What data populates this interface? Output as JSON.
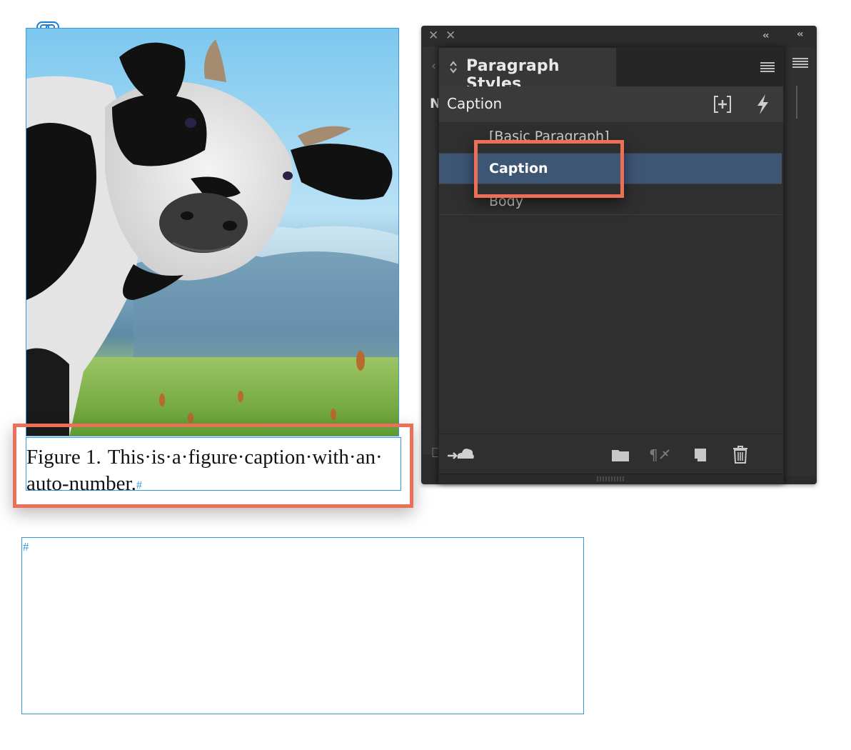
{
  "document": {
    "caption": {
      "number": "Figure 1.",
      "line1": "This·is·a·figure·caption·with·an·",
      "line2": "auto-number.",
      "end_marker": "#"
    },
    "empty_frame_marker": "#"
  },
  "panel": {
    "tab_title": "Paragraph Styles",
    "current_style": "Caption",
    "back_panel_letter": "N",
    "styles": [
      {
        "label": "[Basic Paragraph]",
        "selected": false
      },
      {
        "label": "Caption",
        "selected": true
      },
      {
        "label": "Body",
        "selected": false
      }
    ],
    "icons": {
      "close": "close-icon",
      "collapse": "double-chevron-left-icon",
      "menu": "panel-menu-icon",
      "new_style": "new-style-icon",
      "quick_apply": "lightning-icon",
      "cc_library": "cc-library-icon",
      "folder": "new-group-folder-icon",
      "clear_overrides": "clear-overrides-icon",
      "create_style": "create-new-style-icon",
      "delete": "trash-icon"
    }
  },
  "colors": {
    "frame_blue": "#3a9ad9",
    "highlight": "#ec7057",
    "selection": "#3d5674",
    "panel_bg": "#2f2f2f"
  }
}
